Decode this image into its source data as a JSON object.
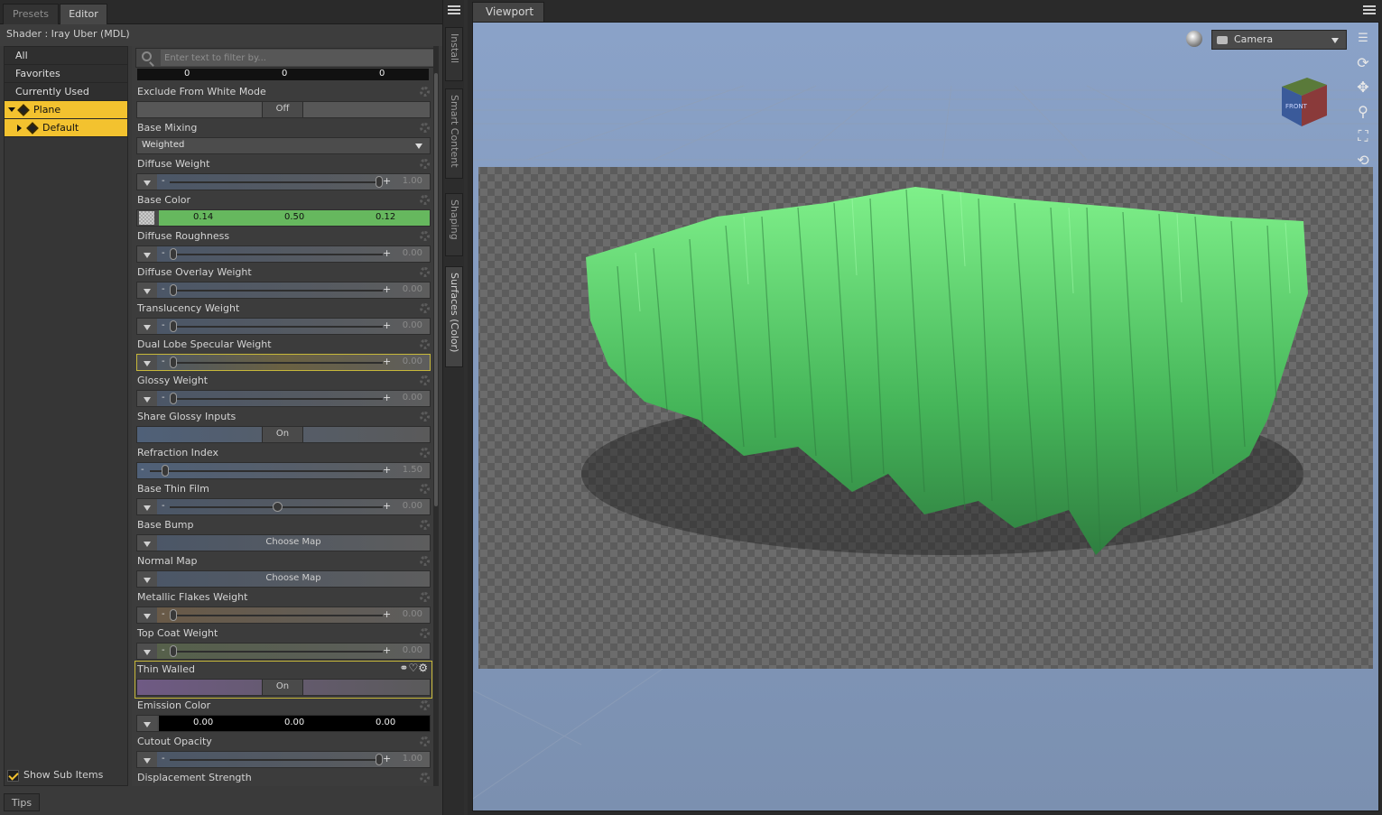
{
  "tabs": {
    "presets": "Presets",
    "editor": "Editor"
  },
  "shader_line": "Shader :  Iray Uber (MDL)",
  "tree": {
    "items": [
      "All",
      "Favorites",
      "Currently Used",
      "Plane",
      "Default"
    ]
  },
  "show_sub_items": "Show Sub Items",
  "filter_placeholder": "Enter text to filter by...",
  "top_row": [
    "0",
    "0",
    "0"
  ],
  "props": {
    "exclude_white": {
      "label": "Exclude From White Mode",
      "value": "Off"
    },
    "base_mixing": {
      "label": "Base Mixing",
      "value": "Weighted"
    },
    "diffuse_weight": {
      "label": "Diffuse Weight",
      "value": "1.00",
      "level": 1.0
    },
    "base_color": {
      "label": "Base Color",
      "r": "0.14",
      "g": "0.50",
      "b": "0.12",
      "hex": "#66b85e"
    },
    "diffuse_roughness": {
      "label": "Diffuse Roughness",
      "value": "0.00",
      "level": 0.0
    },
    "diffuse_overlay": {
      "label": "Diffuse Overlay Weight",
      "value": "0.00",
      "level": 0.0
    },
    "translucency": {
      "label": "Translucency Weight",
      "value": "0.00",
      "level": 0.0
    },
    "dual_lobe": {
      "label": "Dual Lobe Specular Weight",
      "value": "0.00",
      "level": 0.0
    },
    "glossy": {
      "label": "Glossy Weight",
      "value": "0.00",
      "level": 0.0
    },
    "share_glossy": {
      "label": "Share Glossy Inputs",
      "value": "On"
    },
    "refraction": {
      "label": "Refraction Index",
      "value": "1.50",
      "level": 0.05
    },
    "thin_film": {
      "label": "Base Thin Film",
      "value": "0.00",
      "level": 0.5
    },
    "base_bump": {
      "label": "Base Bump",
      "value": "Choose Map"
    },
    "normal_map": {
      "label": "Normal Map",
      "value": "Choose Map"
    },
    "metallic_flakes": {
      "label": "Metallic Flakes Weight",
      "value": "0.00",
      "level": 0.0
    },
    "top_coat": {
      "label": "Top Coat Weight",
      "value": "0.00",
      "level": 0.0
    },
    "thin_walled": {
      "label": "Thin Walled",
      "value": "On"
    },
    "emission_color": {
      "label": "Emission Color",
      "r": "0.00",
      "g": "0.00",
      "b": "0.00"
    },
    "cutout_opacity": {
      "label": "Cutout Opacity",
      "value": "1.00",
      "level": 1.0
    },
    "displacement": {
      "label": "Displacement Strength"
    }
  },
  "vtabs": [
    "Install",
    "Smart Content",
    "Shaping",
    "Surfaces (Color)"
  ],
  "tips": "Tips",
  "viewport": {
    "tab": "Viewport",
    "camera": "Camera",
    "cube_label": "FRONT"
  },
  "colors": {
    "accent": "#f3c22f",
    "grass": "#5fd66a",
    "sky": "#7f94b6"
  }
}
